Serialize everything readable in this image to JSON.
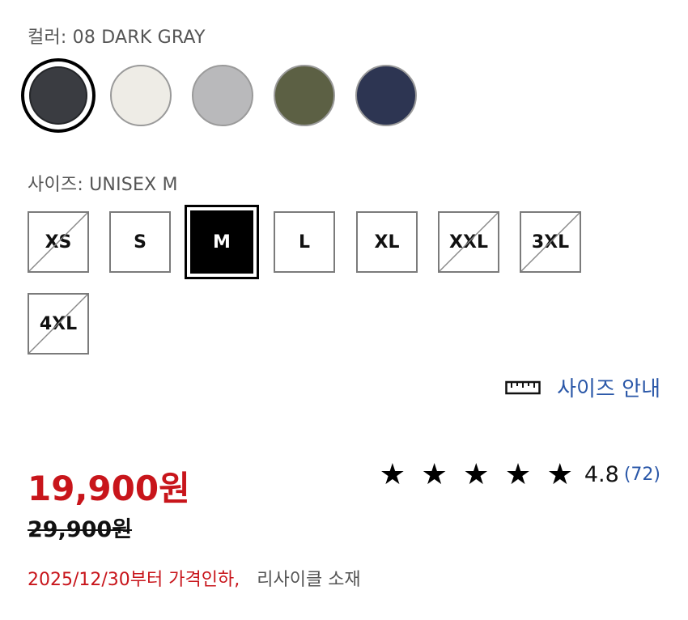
{
  "color": {
    "label": "컬러: 08 DARK GRAY",
    "swatches": [
      {
        "name": "08 DARK GRAY",
        "hex": "#3a3c41",
        "selected": true
      },
      {
        "name": "OFF WHITE",
        "hex": "#eeece6",
        "selected": false
      },
      {
        "name": "GRAY",
        "hex": "#b9b9bb",
        "selected": false
      },
      {
        "name": "OLIVE",
        "hex": "#5c6044",
        "selected": false
      },
      {
        "name": "NAVY",
        "hex": "#2d3552",
        "selected": false
      }
    ]
  },
  "size": {
    "label": "사이즈: UNISEX M",
    "options": [
      {
        "label": "XS",
        "available": false,
        "selected": false
      },
      {
        "label": "S",
        "available": true,
        "selected": false
      },
      {
        "label": "M",
        "available": true,
        "selected": true
      },
      {
        "label": "L",
        "available": true,
        "selected": false
      },
      {
        "label": "XL",
        "available": true,
        "selected": false
      },
      {
        "label": "XXL",
        "available": false,
        "selected": false
      },
      {
        "label": "3XL",
        "available": false,
        "selected": false
      },
      {
        "label": "4XL",
        "available": false,
        "selected": false
      }
    ],
    "guide_label": "사이즈 안내",
    "guide_icon": "ruler-icon"
  },
  "price": {
    "sale": "19,900원",
    "original": "29,900원"
  },
  "rating": {
    "stars": "★ ★ ★ ★ ★",
    "value": "4.8",
    "count": "(72)"
  },
  "notice": {
    "price_change": "2025/12/30부터 가격인하,",
    "material": "리사이클 소재"
  },
  "colors": {
    "sale_red": "#c8151b",
    "link_blue": "#2a57a8"
  }
}
